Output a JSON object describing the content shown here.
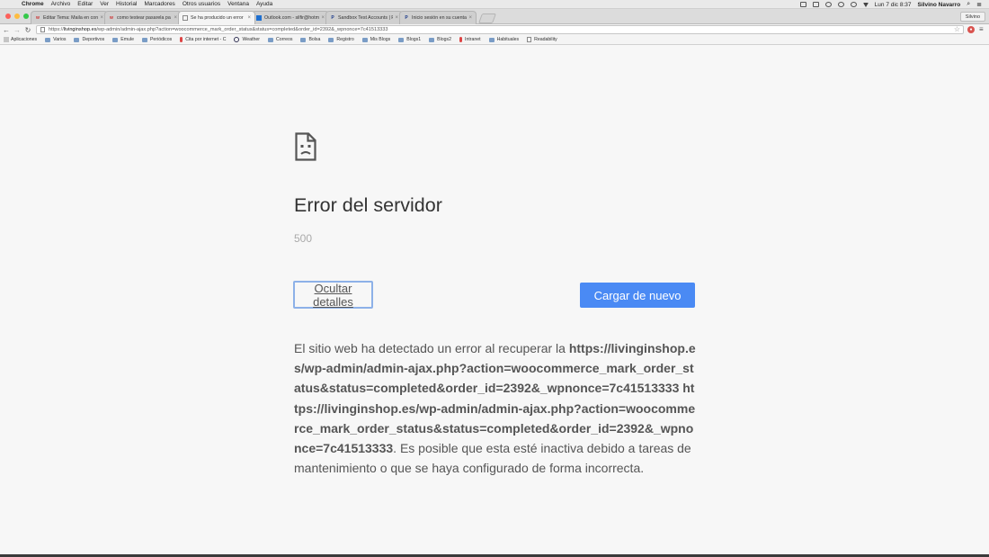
{
  "menubar": {
    "apple": "",
    "items": [
      "Chrome",
      "Archivo",
      "Editar",
      "Ver",
      "Historial",
      "Marcadores",
      "Otros usuarios",
      "Ventana",
      "Ayuda"
    ],
    "clock": "Lun 7 dic  8:37",
    "user": "Silvino Navarro"
  },
  "tabs": [
    {
      "label": "Editar Tema: Maila en con",
      "favicon": "w",
      "favcolor": "#c33"
    },
    {
      "label": "como testear pasarela pa",
      "favicon": "w",
      "favcolor": "#c33"
    },
    {
      "label": "Se ha producido un error",
      "favicon": "",
      "favcolor": "#888"
    },
    {
      "label": "Outlook.com - silfir@hotm",
      "favicon": "",
      "favcolor": "#1e6fd0"
    },
    {
      "label": "Sandbox Test Accounts | F",
      "favicon": "P",
      "favcolor": "#1b3a8a"
    },
    {
      "label": "Inicio sesión en su cuenta",
      "favicon": "P",
      "favcolor": "#1b3a8a"
    }
  ],
  "profile": "Silvino",
  "url": {
    "scheme": "https://",
    "host": "livinginshop.es",
    "path": "/wp-admin/admin-ajax.php?action=woocommerce_mark_order_status&status=completed&order_id=2392&_wpnonce=7c41513333"
  },
  "bookmarks": [
    {
      "label": "Aplicaciones",
      "icon": "apps-icon"
    },
    {
      "label": "Varios",
      "icon": "folder-icon"
    },
    {
      "label": "Deportivos",
      "icon": "folder-icon"
    },
    {
      "label": "Emule",
      "icon": "folder-icon"
    },
    {
      "label": "Periódicos",
      "icon": "folder-icon"
    },
    {
      "label": "Cita por internet - C",
      "icon": "pin-icon"
    },
    {
      "label": "Weather",
      "icon": "circle-icon"
    },
    {
      "label": "Correos",
      "icon": "folder-icon"
    },
    {
      "label": "Bolsa",
      "icon": "folder-icon"
    },
    {
      "label": "Registro",
      "icon": "folder-icon"
    },
    {
      "label": "Mis Blogs",
      "icon": "folder-icon"
    },
    {
      "label": "Blogs1",
      "icon": "folder-icon"
    },
    {
      "label": "Blogs2",
      "icon": "folder-icon"
    },
    {
      "label": "Intranet",
      "icon": "pin-icon"
    },
    {
      "label": "Habituales",
      "icon": "folder-icon"
    },
    {
      "label": "Readability",
      "icon": "doc-icon"
    }
  ],
  "error": {
    "title": "Error del servidor",
    "code": "500",
    "details_button": "Ocultar detalles",
    "reload_button": "Cargar de nuevo",
    "details_intro": "El sitio web ha detectado un error al recuperar la ",
    "details_url": "https://livinginshop.es/wp-admin/admin-ajax.php?action=woocommerce_mark_order_status&status=completed&order_id=2392&_wpnonce=7c41513333 https://livinginshop.es/wp-admin/admin-ajax.php?action=woocommerce_mark_order_status&status=completed&order_id=2392&_wpnonce=7c41513333",
    "details_outro": ". Es posible que esta esté inactiva debido a tareas de mantenimiento o que se haya configurado de forma incorrecta."
  }
}
